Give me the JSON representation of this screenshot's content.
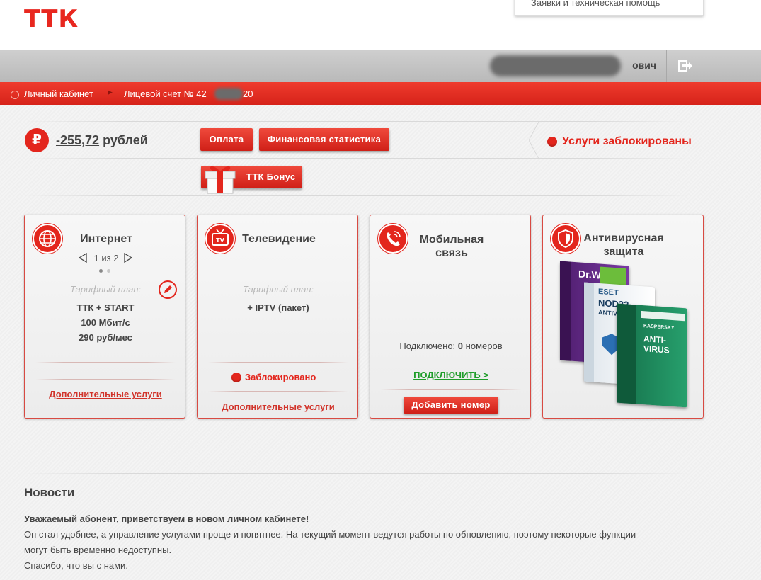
{
  "header": {
    "logo": "ТТК",
    "support_menu_item": "Заявки и техническая помощь",
    "user_name_visible": "ович"
  },
  "breadcrumb": {
    "items": [
      "Личный кабинет",
      "Лицевой счет № 42",
      "20"
    ]
  },
  "balance": {
    "amount": "-255,72",
    "currency": "рублей",
    "ruble_symbol": "₽"
  },
  "actions": {
    "payment": "Оплата",
    "stats": "Финансовая статистика",
    "bonus": "ТТК Бонус"
  },
  "status": {
    "text": "Услуги заблокированы",
    "color": "#e3261d"
  },
  "cards": {
    "internet": {
      "title": "Интернет",
      "pager": "1 из 2",
      "page_current": 1,
      "page_total": 2,
      "plan_label": "Тарифный план:",
      "plan_lines": [
        "ТТК + START",
        "100 Мбит/с",
        "290 руб/мес"
      ],
      "extra_link": "Дополнительные услуги",
      "icon": "globe-icon"
    },
    "tv": {
      "title": "Телевидение",
      "plan_label": "Тарифный план:",
      "plan_lines": [
        "+ IPTV (пакет)"
      ],
      "status": "Заблокировано",
      "extra_link": "Дополнительные услуги",
      "icon": "tv-icon"
    },
    "mobile": {
      "title_lines": [
        "Мобильная",
        "связь"
      ],
      "connected_prefix": "Подключено:",
      "connected_count": "0",
      "connected_suffix": "номеров",
      "connect_link": "ПОДКЛЮЧИТЬ >",
      "add_button": "Добавить номер",
      "icon": "phone-icon"
    },
    "antivirus": {
      "title_lines": [
        "Антивирусная",
        "защита"
      ],
      "icon": "shield-icon",
      "boxes": [
        {
          "brand": "Dr.WEB",
          "color": "#6b2f8f"
        },
        {
          "brand": "ESET",
          "line2": "NOD32",
          "line3": "ANTIVIRUS 6",
          "color": "#f4f4f4"
        },
        {
          "brand": "KASPERSKY",
          "line2": "ANTI-VIRUS",
          "color": "#1e8a5c"
        }
      ]
    }
  },
  "news": {
    "title": "Новости",
    "headline": "Уважаемый абонент, приветствуем в новом личном кабинете!",
    "line1": "Он стал удобнее, а управление услугами проще и понятнее. На текущий момент ведутся работы по обновлению, поэтому некоторые функции",
    "line2": "могут быть временно недоступны.",
    "line3": "Спасибо, что вы с нами."
  },
  "colors": {
    "brand_red": "#e3261d",
    "link_green": "#1f9d2a"
  }
}
